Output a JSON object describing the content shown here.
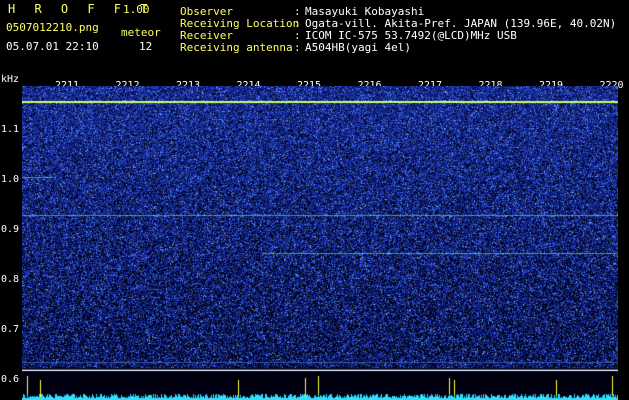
{
  "header": {
    "app_name": "H R O F F T",
    "version": "1.00",
    "filename": "0507012210.png",
    "datetime": "05.07.01 22:10",
    "counter_label": "meteor",
    "counter_value": "12",
    "fields": [
      {
        "label": "Observer",
        "value": "Masayuki Kobayashi"
      },
      {
        "label": "Receiving Location",
        "value": "Ogata-vill. Akita-Pref. JAPAN (139.96E, 40.02N)"
      },
      {
        "label": "Receiver",
        "value": "ICOM IC-575 53.7492(@LCD)MHz USB"
      },
      {
        "label": "Receiving antenna",
        "value": "A504HB(yagi 4el)"
      }
    ],
    "separator": ":"
  },
  "spectrogram": {
    "y_unit": "kHz",
    "y_ticks": [
      "1.1",
      "1.0",
      "0.9",
      "0.8",
      "0.7",
      "0.6"
    ],
    "x_ticks": [
      "2211",
      "2212",
      "2213",
      "2214",
      "2215",
      "2216",
      "2217",
      "2218",
      "2219",
      "2220"
    ],
    "colors": {
      "background": "#000010",
      "noise_dark": "#0a1a6a",
      "noise_light": "#3a6ae0",
      "trace": "#66ffcc",
      "carrier": "#ccff66",
      "spike": "#ffff33",
      "baseline": "#33ddff"
    }
  }
}
